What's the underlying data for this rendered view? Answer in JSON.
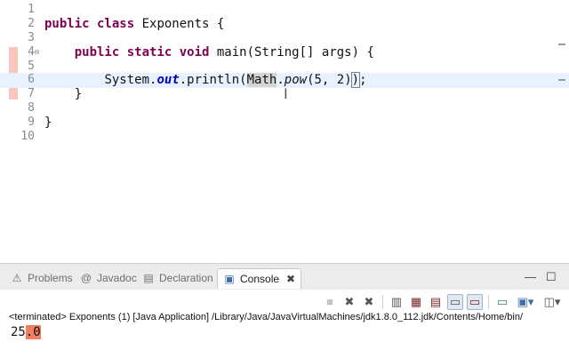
{
  "editor": {
    "class_name": "Exponents",
    "lines": [
      {
        "num": "1",
        "text": ""
      },
      {
        "num": "2",
        "kw": "public class",
        "text": " Exponents {"
      },
      {
        "num": "3",
        "text": ""
      },
      {
        "num": "4",
        "fold": "⊖",
        "indent": "    ",
        "kw": "public static void",
        "text": " main(String[] args) {"
      },
      {
        "num": "5",
        "text": ""
      },
      {
        "num": "6",
        "indent": "        ",
        "pre": "System.",
        "field": "out",
        "mid": ".println(",
        "cls": "Math",
        "dot": ".",
        "method": "pow",
        "args": "(5, 2)",
        "bracket": ")",
        "end": ";"
      },
      {
        "num": "7",
        "text": "    }"
      },
      {
        "num": "8",
        "text": ""
      },
      {
        "num": "9",
        "text": "}"
      },
      {
        "num": "10",
        "text": ""
      }
    ],
    "colors": {
      "keyword": "#7f0055",
      "field": "#0000c0",
      "change_bar": "#f6c6bf",
      "current_line": "#e8f2fe"
    }
  },
  "panel": {
    "tabs": [
      {
        "icon": "problems-icon",
        "label": "Problems"
      },
      {
        "icon": "javadoc-icon",
        "label": "Javadoc"
      },
      {
        "icon": "declaration-icon",
        "label": "Declaration"
      },
      {
        "icon": "console-icon",
        "label": "Console",
        "active": true
      }
    ],
    "close_glyph": "✖",
    "minimize_glyph": "—",
    "maximize_glyph": "☐"
  },
  "console": {
    "toolbar": [
      "terminate-icon",
      "remove-launch-icon",
      "remove-all-terminated-icon",
      "clear-console-icon",
      "scroll-lock-icon",
      "word-wrap-icon",
      "show-on-stdout-icon",
      "show-on-stderr-icon",
      "pin-console-icon",
      "display-selected-console-icon",
      "open-console-icon"
    ],
    "status": "<terminated> Exponents (1) [Java Application] /Library/Java/JavaVirtualMachines/jdk1.8.0_112.jdk/Contents/Home/bin/",
    "output_main": "25",
    "output_highlight": ".0"
  }
}
